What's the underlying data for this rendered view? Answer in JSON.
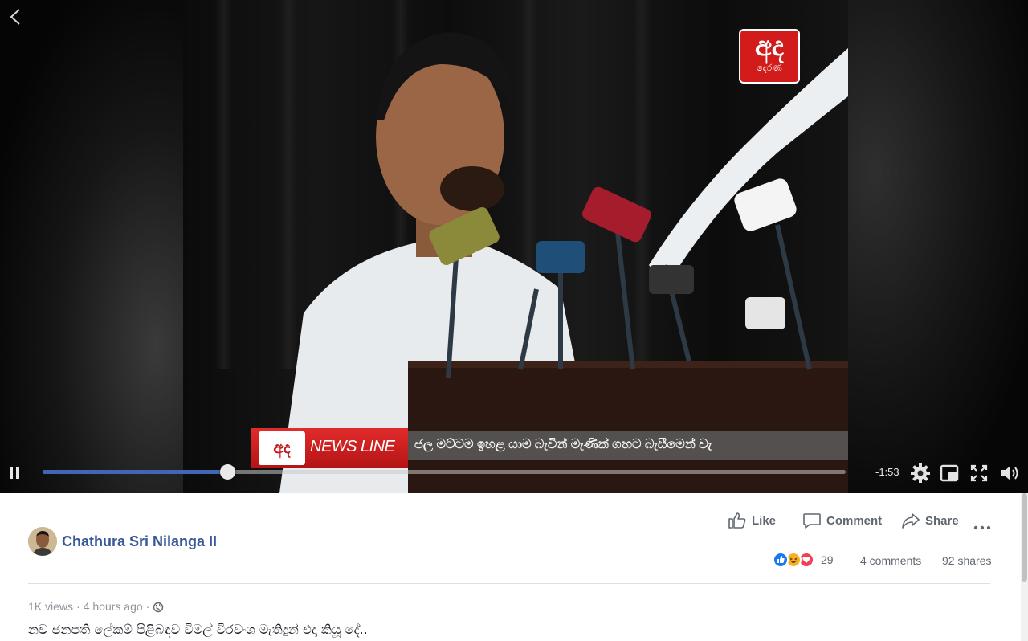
{
  "video": {
    "logo_big": "අද",
    "logo_small": "දෙරණ",
    "ticker_logo": "අද",
    "ticker_brand": "NEWS LINE",
    "ticker_text": "ජල මට්ටම ඉහළ යාම බැවින් මැණික් ගඟට බැසීමෙන් වැ",
    "progress_fraction": 0.23,
    "time_remaining": "-1:53",
    "icons": [
      "back-icon",
      "pause-icon",
      "settings-icon",
      "pip-icon",
      "fullscreen-icon",
      "volume-icon"
    ]
  },
  "actions": {
    "like_label": "Like",
    "comment_label": "Comment",
    "share_label": "Share"
  },
  "author": {
    "name": "Chathura Sri Nilanga II"
  },
  "stats": {
    "reaction_icons": [
      "like-reaction",
      "haha-reaction",
      "love-reaction"
    ],
    "reaction_count": "29",
    "comments": "4 comments",
    "shares": "92 shares"
  },
  "meta": {
    "views": "1K views",
    "time": "4 hours ago"
  },
  "caption": "නව ජනපති ලේකම් පිළිබඳව විමල් වීරවංශ මැතිදුන් එදා කියූ දේ..",
  "colors": {
    "accent": "#4267b2",
    "author_link": "#385898",
    "ticker_red": "#d21c1c"
  }
}
